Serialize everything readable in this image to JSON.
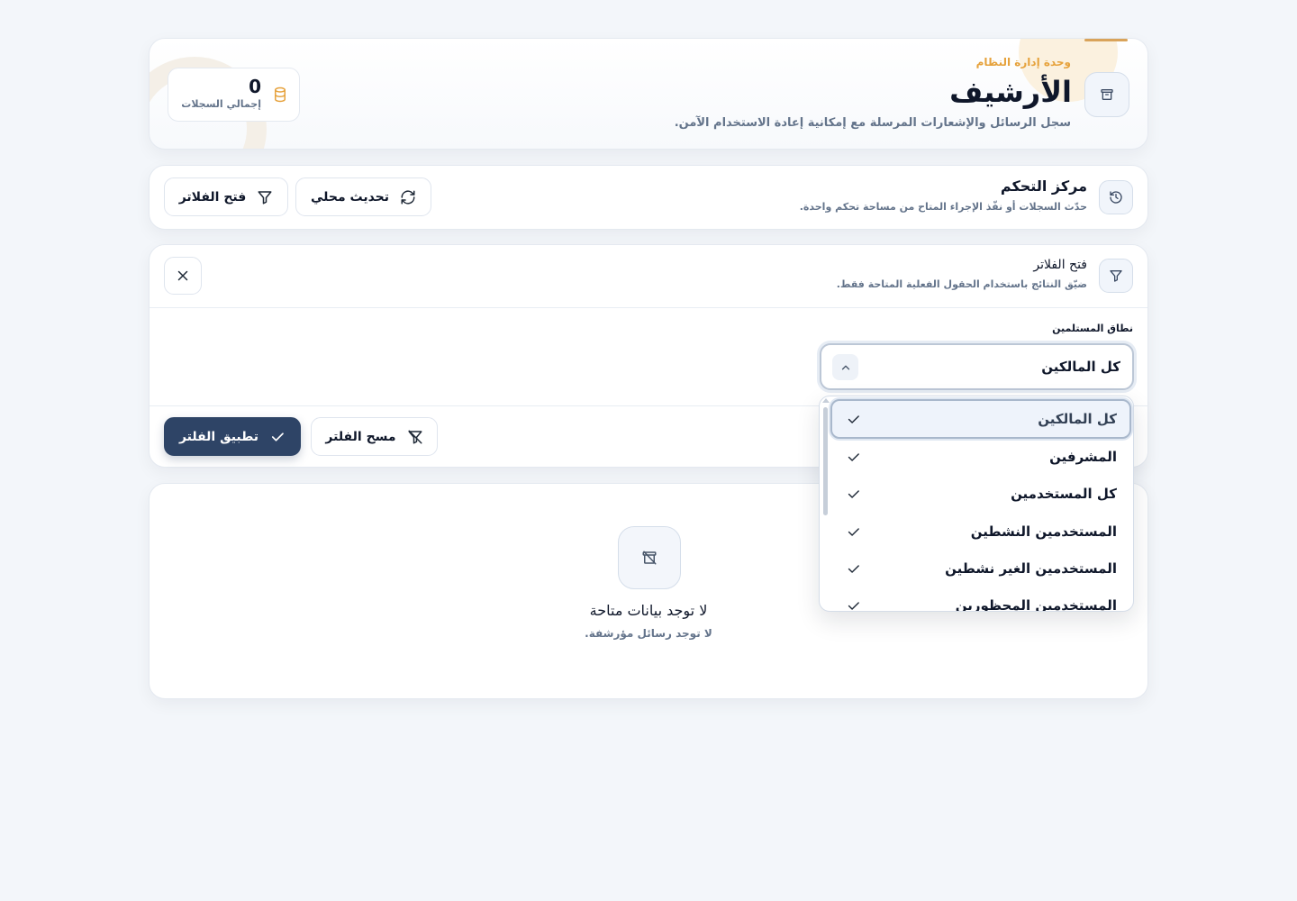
{
  "header": {
    "kicker": "وحدة إدارة النظام",
    "title": "الأرشيف",
    "subtitle": "سجل الرسائل والإشعارات المرسلة مع إمكانية إعادة الاستخدام الآمن.",
    "stat_value": "0",
    "stat_label": "إجمالي السجلات"
  },
  "toolbar": {
    "title": "مركز التحكم",
    "subtitle": "حدّث السجلات أو نفّذ الإجراء المتاح من مساحة تحكم واحدة.",
    "refresh_label": "تحديث محلي",
    "open_filters_label": "فتح الفلاتر"
  },
  "filters": {
    "title": "فتح الفلاتر",
    "subtitle": "ضيّق النتائج باستخدام الحقول الفعلية المتاحة فقط.",
    "field_label": "نطاق المستلمين",
    "selected_value": "كل المالكين",
    "clear_label": "مسح الفلتر",
    "apply_label": "تطبيق الفلتر",
    "options": [
      "كل المالكين",
      "المشرفين",
      "كل المستخدمين",
      "المستخدمين النشطين",
      "المستخدمين الغير نشطين",
      "المستخدمين المحظورين"
    ]
  },
  "empty": {
    "title": "لا توجد بيانات متاحة",
    "subtitle": "لا توجد رسائل مؤرشفة."
  },
  "colors": {
    "accent_orange": "#e6a23c",
    "primary_dark": "#2e4466",
    "muted_text": "#64748b"
  },
  "icons": {
    "header": "archive-icon",
    "stat": "database-icon",
    "toolbar": "history-icon",
    "refresh": "refresh-icon",
    "filter": "filter-icon",
    "clear": "filter-off-icon",
    "apply": "check-icon",
    "close": "close-icon",
    "empty": "archive-off-icon"
  }
}
